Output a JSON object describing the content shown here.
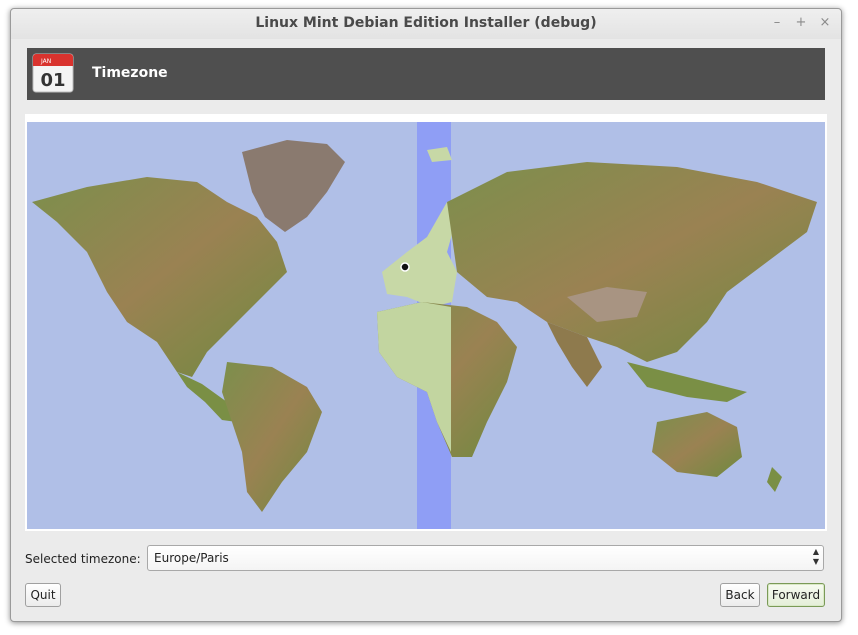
{
  "window": {
    "title": "Linux Mint Debian Edition Installer (debug)",
    "controls": {
      "minimize": "–",
      "maximize": "+",
      "close": "×"
    }
  },
  "header": {
    "title": "Timezone",
    "calendar_icon": {
      "month": "JAN",
      "day": "01",
      "accent_color": "#d9332e"
    }
  },
  "map": {
    "ocean_color": "#b0bfe7",
    "highlight_color": "#8f9ef5",
    "selected_location": "Europe/Paris"
  },
  "timezone": {
    "label": "Selected timezone:",
    "value": "Europe/Paris"
  },
  "buttons": {
    "quit": "Quit",
    "back": "Back",
    "forward": "Forward"
  }
}
